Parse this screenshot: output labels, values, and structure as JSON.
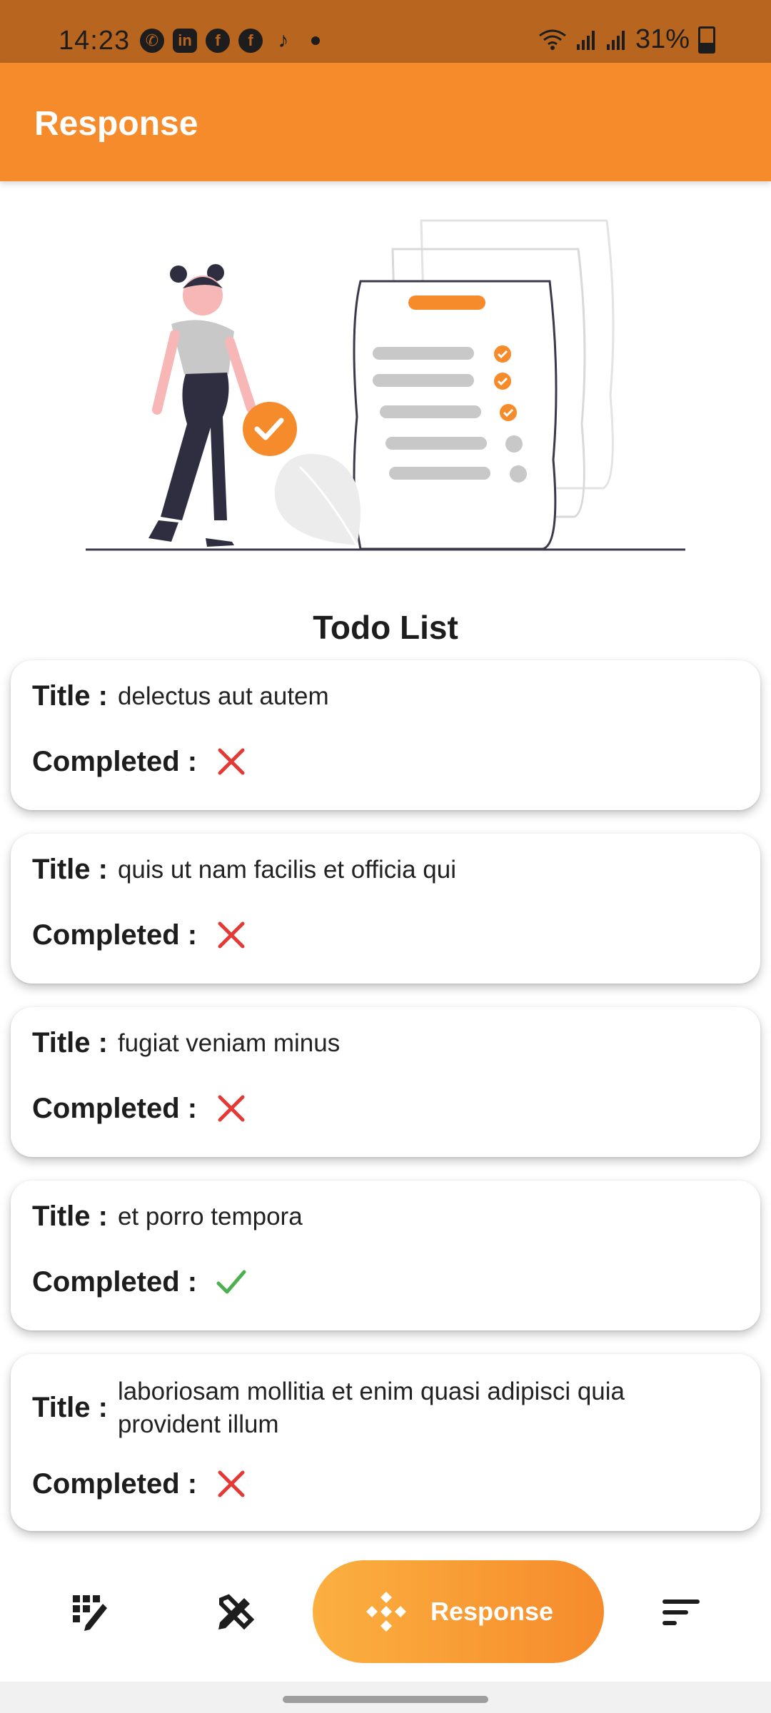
{
  "status_bar": {
    "time": "14:23",
    "battery": "31%",
    "notification_icons": [
      "whatsapp-icon",
      "linkedin-icon",
      "facebook-icon",
      "facebook-icon",
      "tiktok-icon"
    ]
  },
  "app_bar": {
    "title": "Response"
  },
  "section_title": "Todo List",
  "todo_labels": {
    "title": "Title :",
    "completed": "Completed :"
  },
  "todos": [
    {
      "title": "delectus aut autem",
      "completed": false
    },
    {
      "title": "quis ut nam facilis et officia qui",
      "completed": false
    },
    {
      "title": "fugiat veniam minus",
      "completed": false
    },
    {
      "title": "et porro tempora",
      "completed": true
    },
    {
      "title": "laboriosam mollitia et enim quasi adipisci quia provident illum",
      "completed": false
    }
  ],
  "bottom_nav": {
    "items": [
      {
        "icon": "grid-edit-icon"
      },
      {
        "icon": "design-tools-icon"
      },
      {
        "icon": "response-icon",
        "label": "Response",
        "active": true
      },
      {
        "icon": "sort-icon"
      }
    ]
  },
  "colors": {
    "accent": "#f68b2c",
    "status_bar": "#b8651f",
    "completed_true": "#4caf50",
    "completed_false": "#e53935"
  }
}
